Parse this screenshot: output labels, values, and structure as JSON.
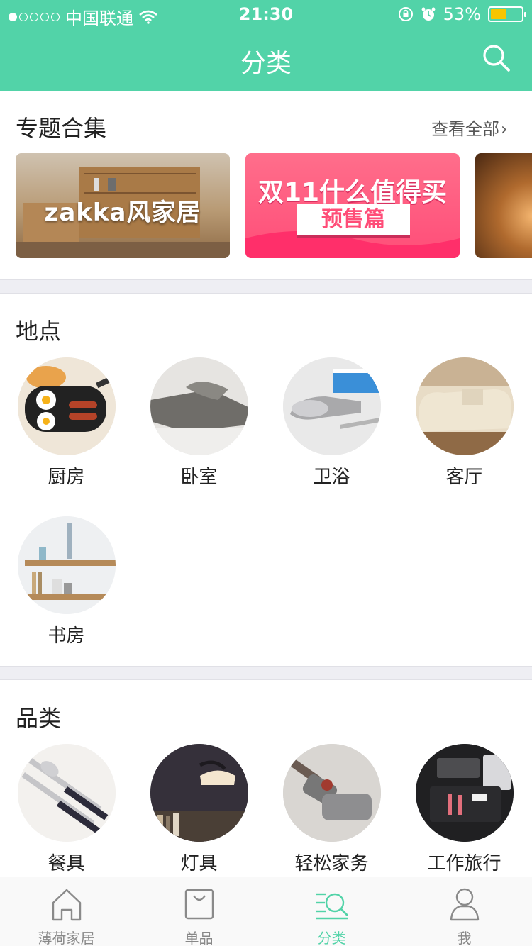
{
  "status_bar": {
    "carrier": "中国联通",
    "time": "21:30",
    "battery": "53%",
    "battery_level": 0.53
  },
  "nav": {
    "title": "分类"
  },
  "topics": {
    "title": "专题合集",
    "view_all": "查看全部",
    "banners": [
      {
        "text": "zakka风家居"
      },
      {
        "line1": "双11什么值得买",
        "line2": "预售篇"
      },
      {
        "text": ""
      }
    ]
  },
  "places": {
    "title": "地点",
    "items": [
      {
        "label": "厨房"
      },
      {
        "label": "卧室"
      },
      {
        "label": "卫浴"
      },
      {
        "label": "客厅"
      },
      {
        "label": "书房"
      }
    ]
  },
  "categories": {
    "title": "品类",
    "items": [
      {
        "label": "餐具"
      },
      {
        "label": "灯具"
      },
      {
        "label": "轻松家务"
      },
      {
        "label": "工作旅行"
      }
    ]
  },
  "tabbar": {
    "tabs": [
      {
        "label": "薄荷家居"
      },
      {
        "label": "单品"
      },
      {
        "label": "分类"
      },
      {
        "label": "我"
      }
    ]
  },
  "colors": {
    "brand": "#52d3a8",
    "battery": "#f7c500"
  }
}
